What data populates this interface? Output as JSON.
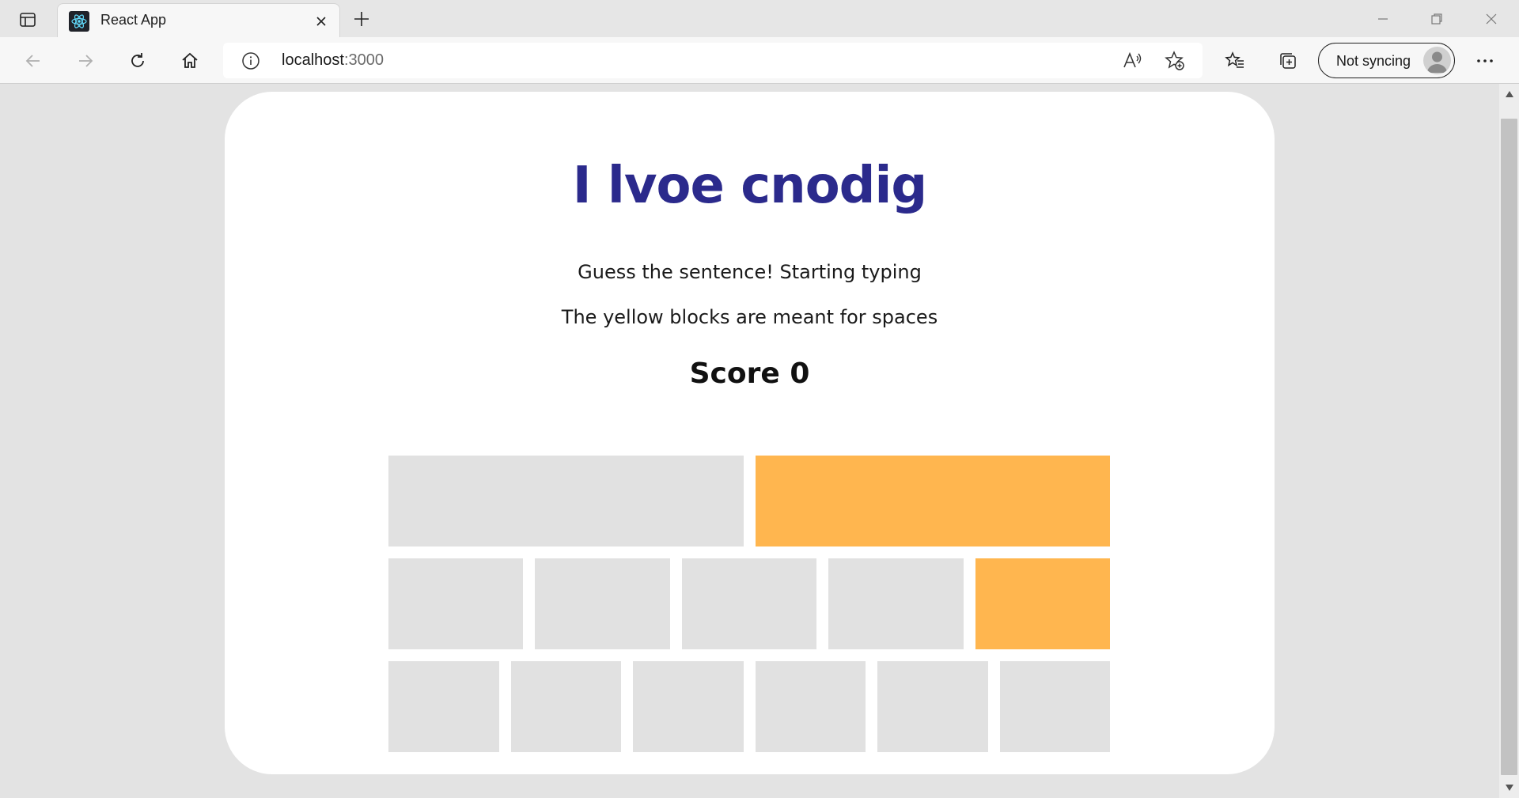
{
  "browser": {
    "tab_title": "React App",
    "address_host": "localhost",
    "address_port": ":3000",
    "profile_label": "Not syncing"
  },
  "page": {
    "title": "I lvoe cnodig",
    "instruction_1": "Guess the sentence! Starting typing",
    "instruction_2": "The yellow blocks are meant for spaces",
    "score_label": "Score",
    "score_value": "0"
  },
  "colors": {
    "title": "#2b2a8c",
    "letter_block": "#e1e1e1",
    "space_block": "#ffb64f",
    "card": "#ffffff",
    "page_bg": "#e3e3e3"
  },
  "blocks": [
    [
      "letter",
      "space"
    ],
    [
      "letter",
      "letter",
      "letter",
      "letter",
      "space"
    ],
    [
      "letter",
      "letter",
      "letter",
      "letter",
      "letter",
      "letter"
    ]
  ]
}
